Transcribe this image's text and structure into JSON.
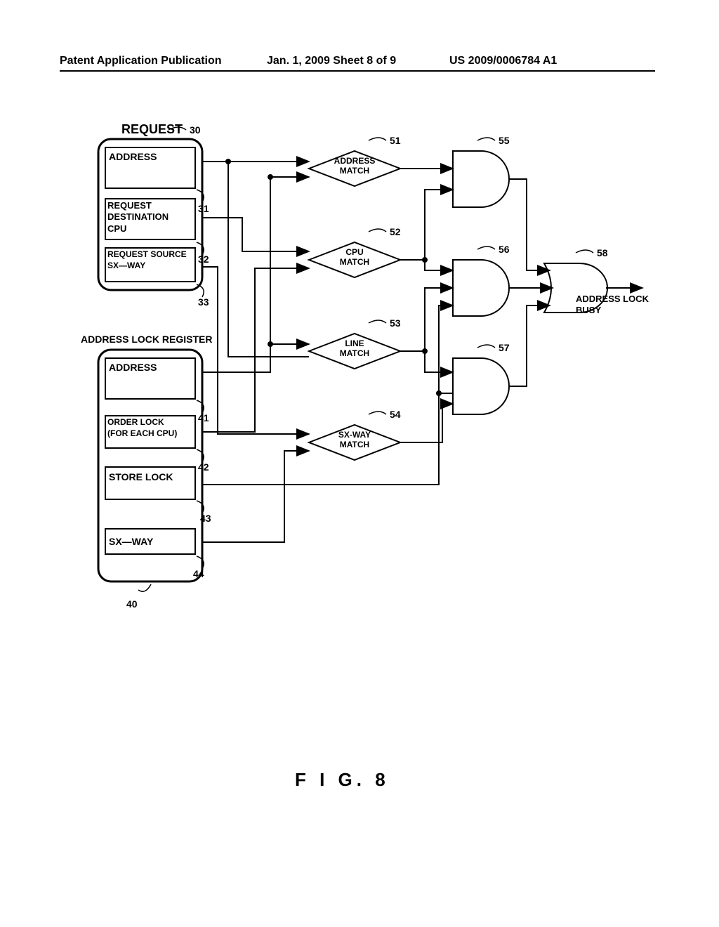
{
  "header": {
    "left": "Patent Application Publication",
    "center": "Jan. 1, 2009   Sheet 8 of 9",
    "right": "US 2009/0006784 A1"
  },
  "figure_caption": "F I G.   8",
  "request_block": {
    "title": "REQUEST",
    "ref": "30",
    "fields": {
      "address": {
        "label": "ADDRESS",
        "ref": "31"
      },
      "dest_cpu": {
        "label": "REQUEST\nDESTINATION\nCPU",
        "ref": "32"
      },
      "source": {
        "label": "REQUEST SOURCE\nSX—WAY",
        "ref": "33"
      }
    }
  },
  "lockreg_block": {
    "title": "ADDRESS LOCK REGISTER",
    "ref": "40",
    "fields": {
      "address": {
        "label": "ADDRESS",
        "ref": "41"
      },
      "order_lock": {
        "label": "ORDER LOCK\n(FOR EACH CPU)",
        "ref": "42"
      },
      "store_lock": {
        "label": "STORE LOCK",
        "ref": "43"
      },
      "sx_way": {
        "label": "SX—WAY",
        "ref": "44"
      }
    }
  },
  "comparators": {
    "address_match": {
      "label": "ADDRESS\nMATCH",
      "ref": "51"
    },
    "cpu_match": {
      "label": "CPU\nMATCH",
      "ref": "52"
    },
    "line_match": {
      "label": "LINE\nMATCH",
      "ref": "53"
    },
    "sxway_match": {
      "label": "SX-WAY\nMATCH",
      "ref": "54"
    }
  },
  "gates": {
    "and_top": "55",
    "and_mid": "56",
    "and_bot": "57",
    "or_out": "58"
  },
  "output_label": "ADDRESS LOCK\nBUSY"
}
